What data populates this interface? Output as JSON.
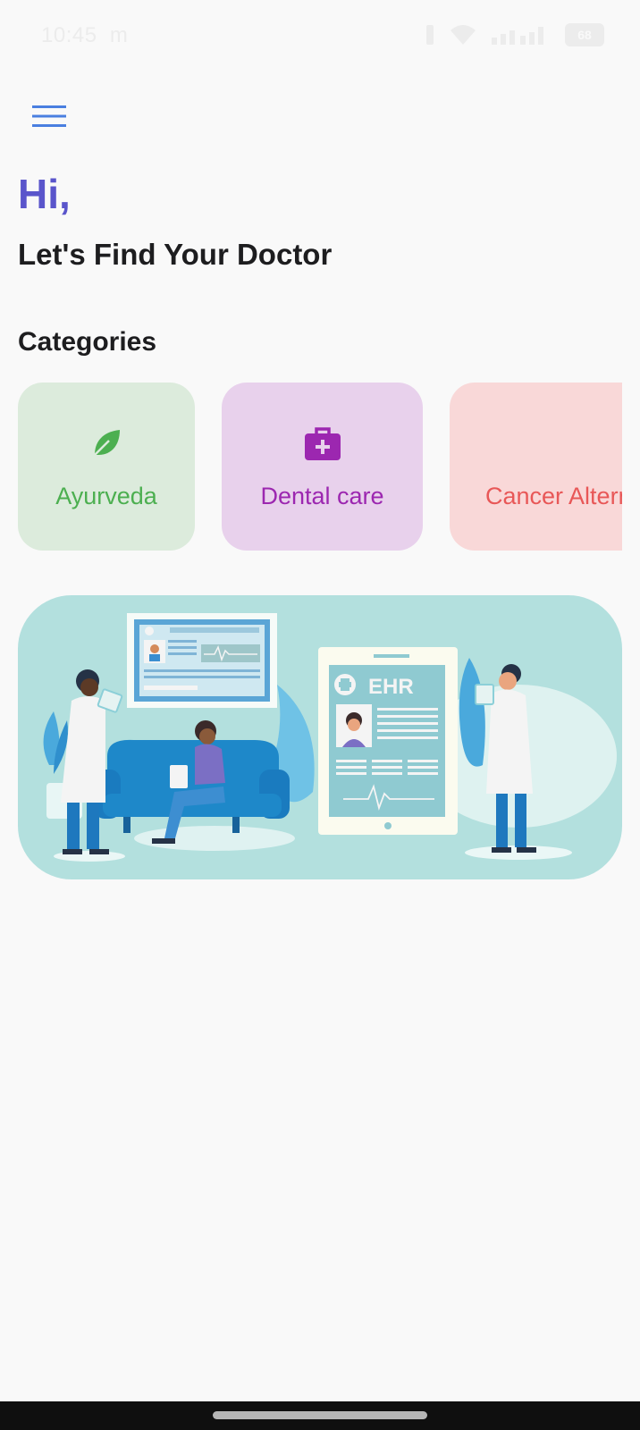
{
  "status_bar": {
    "time": "10:45",
    "carrier_glyph": "m",
    "battery": "68"
  },
  "header": {
    "greeting": "Hi,",
    "subtitle": "Let's Find Your Doctor"
  },
  "categories": {
    "title": "Categories",
    "items": [
      {
        "label": "Ayurveda",
        "icon": "leaf-icon",
        "color": "#4caf50",
        "background": "#dcebdc"
      },
      {
        "label": "Dental care",
        "icon": "medical-bag-icon",
        "color": "#9c27b0",
        "background": "#e8d1ec"
      },
      {
        "label": "Cancer Alternative",
        "icon": "none",
        "color": "#e85757",
        "background": "#f9d8d8"
      }
    ]
  },
  "banner": {
    "ehr_text": "EHR"
  },
  "colors": {
    "accent": "#5a55cb",
    "menu": "#4a7fe0",
    "banner_bg": "#b3e0de",
    "sofa": "#1e88c9"
  }
}
